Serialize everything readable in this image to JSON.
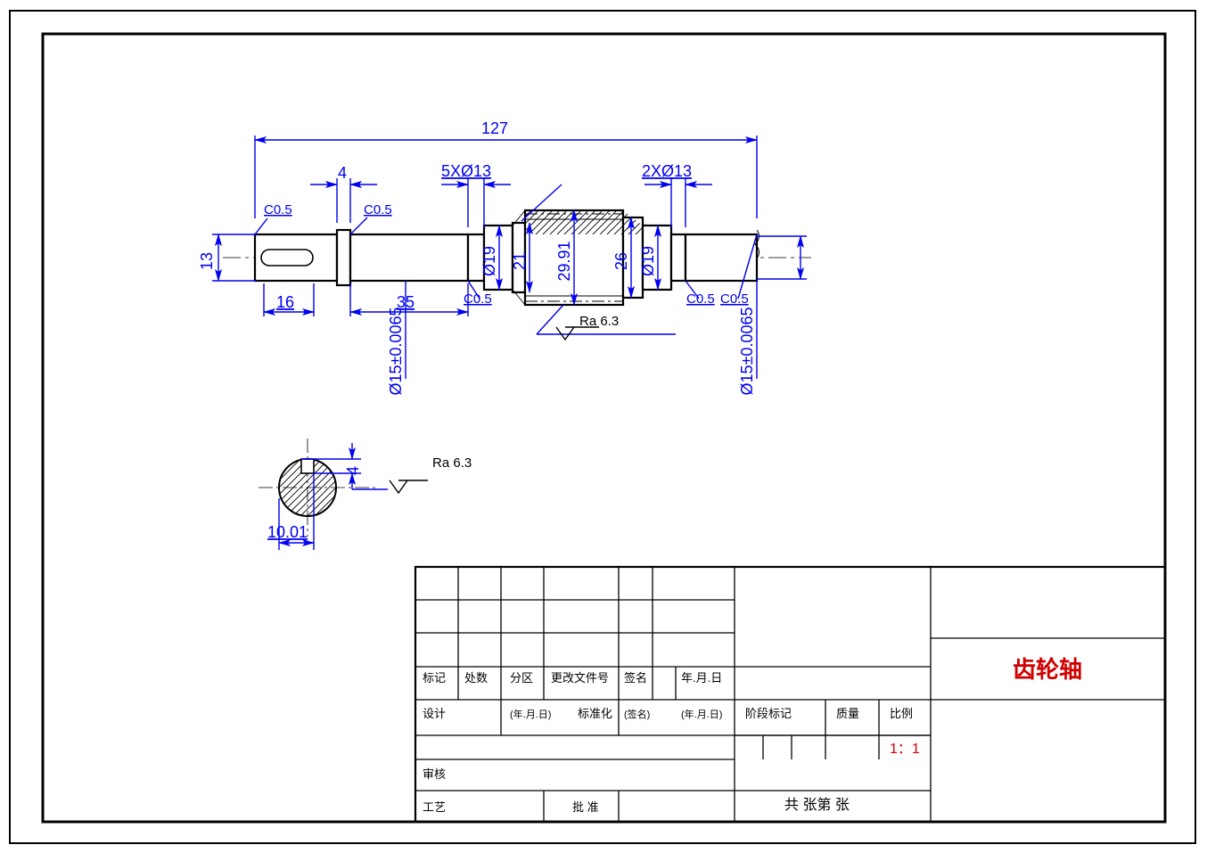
{
  "drawing": {
    "title": "齿轮轴",
    "scale": "1：1",
    "sheet_info": "共 张第 张",
    "dimensions": {
      "overall_length": "127",
      "key_width_top": "4",
      "key_width_section": "4",
      "d_left": "13",
      "len_key_slot": "16",
      "len_step_b": "35",
      "callout_5xd13": "5XØ13",
      "callout_2xd13": "2XØ13",
      "dia_19_a": "Ø19",
      "dia_21": "21",
      "dia_2991": "29.91",
      "dia_26": "26",
      "dia_19_b": "Ø19",
      "dia_15_tol_a": "Ø15±0.0065",
      "dia_15_tol_b": "Ø15±0.0065",
      "section_offset": "10.01",
      "chamfers": {
        "c05_a": "C0.5",
        "c05_b": "C0.5",
        "c05_c": "C0.5",
        "c05_d": "C0.5",
        "c05_e": "C0.5"
      },
      "roughness": "Ra 6.3",
      "roughness_b": "Ra 6.3"
    },
    "titleblock_labels": {
      "mark": "标记",
      "qty": "处数",
      "zone": "分区",
      "change_doc": "更改文件号",
      "sign": "签名",
      "date": "年.月.日",
      "design": "设计",
      "date_small": "(年.月.日)",
      "standardize": "标准化",
      "sign_small": "(签名)",
      "date_small2": "(年.月.日)",
      "check": "审核",
      "process": "工艺",
      "approve": "批 准",
      "stage_mark": "阶段标记",
      "mass": "质量",
      "scale_label": "比例"
    }
  }
}
